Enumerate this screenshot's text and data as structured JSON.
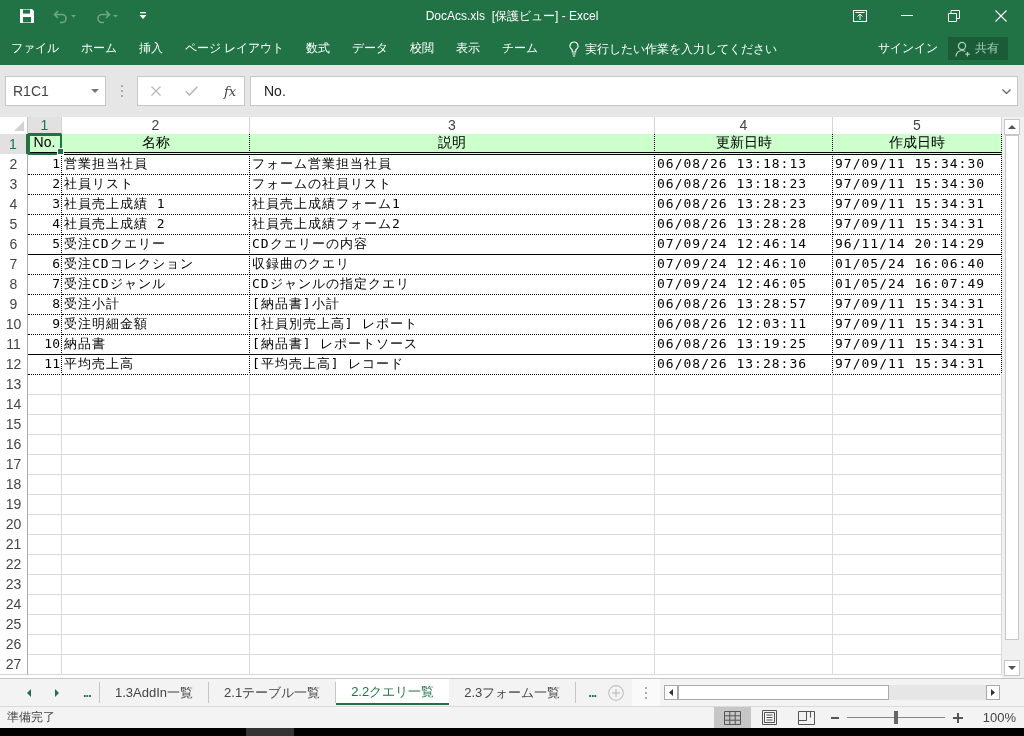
{
  "title_bar": {
    "quick_access": [
      {
        "kind": "save",
        "disabled": false
      },
      {
        "kind": "undo",
        "disabled": true
      },
      {
        "kind": "redo",
        "disabled": true
      },
      {
        "kind": "customize",
        "disabled": false
      }
    ],
    "title": "DocAcs.xls  [保護ビュー] - Excel"
  },
  "ribbon": {
    "tabs": [
      {
        "label": "ファイル",
        "selected": false
      },
      {
        "label": "ホーム",
        "selected": false
      },
      {
        "label": "挿入",
        "selected": false
      },
      {
        "label": "ページ レイアウト",
        "selected": false
      },
      {
        "label": "数式",
        "selected": false
      },
      {
        "label": "データ",
        "selected": false
      },
      {
        "label": "校閲",
        "selected": false
      },
      {
        "label": "表示",
        "selected": false
      },
      {
        "label": "チーム",
        "selected": false
      }
    ],
    "tell_me": {
      "placeholder": "実行したい作業を入力してください"
    },
    "sign_in": "サインイン",
    "share": {
      "label": "共有",
      "disabled": true
    }
  },
  "formula_bar": {
    "name_box": "R1C1",
    "buttons": [
      {
        "kind": "cancel",
        "disabled": true
      },
      {
        "kind": "enter",
        "disabled": true
      }
    ],
    "function_button": "fx",
    "value": "No."
  },
  "sheet": {
    "columns": [
      {
        "number": "1",
        "selected": true
      },
      {
        "number": "2",
        "selected": false
      },
      {
        "number": "3",
        "selected": false
      },
      {
        "number": "4",
        "selected": false
      },
      {
        "number": "5",
        "selected": false
      }
    ],
    "rows": [
      {
        "kind": "header",
        "number": "1",
        "selected": true,
        "cells": [
          "No.",
          "名称",
          "説明",
          "更新日時",
          "作成日時"
        ]
      },
      {
        "kind": "data",
        "number": "2",
        "selected": false,
        "rule_below": false,
        "cells": [
          "1",
          "営業担当社員",
          "フォーム営業担当社員",
          "06/08/26 13:18:13",
          "97/09/11 15:34:30"
        ]
      },
      {
        "kind": "data",
        "number": "3",
        "selected": false,
        "rule_below": false,
        "cells": [
          "2",
          "社員リスト",
          "フォームの社員リスト",
          "06/08/26 13:18:23",
          "97/09/11 15:34:30"
        ]
      },
      {
        "kind": "data",
        "number": "4",
        "selected": false,
        "rule_below": false,
        "cells": [
          "3",
          "社員売上成績 1",
          "社員売上成績フォーム1",
          "06/08/26 13:28:23",
          "97/09/11 15:34:31"
        ]
      },
      {
        "kind": "data",
        "number": "5",
        "selected": false,
        "rule_below": false,
        "cells": [
          "4",
          "社員売上成績 2",
          "社員売上成績フォーム2",
          "06/08/26 13:28:28",
          "97/09/11 15:34:31"
        ]
      },
      {
        "kind": "data",
        "number": "6",
        "selected": false,
        "rule_below": true,
        "cells": [
          "5",
          "受注CDクエリー",
          "CDクエリーの内容",
          "07/09/24 12:46:14",
          "96/11/14 20:14:29"
        ]
      },
      {
        "kind": "data",
        "number": "7",
        "selected": false,
        "rule_below": false,
        "cells": [
          "6",
          "受注CDコレクション",
          "収録曲のクエリ",
          "07/09/24 12:46:10",
          "01/05/24 16:06:40"
        ]
      },
      {
        "kind": "data",
        "number": "8",
        "selected": false,
        "rule_below": false,
        "cells": [
          "7",
          "受注CDジャンル",
          "CDジャンルの指定クエリ",
          "07/09/24 12:46:05",
          "01/05/24 16:07:49"
        ]
      },
      {
        "kind": "data",
        "number": "9",
        "selected": false,
        "rule_below": false,
        "cells": [
          "8",
          "受注小計",
          "[納品書]小計",
          "06/08/26 13:28:57",
          "97/09/11 15:34:31"
        ]
      },
      {
        "kind": "data",
        "number": "10",
        "selected": false,
        "rule_below": false,
        "cells": [
          "9",
          "受注明細金額",
          "[社員別売上高] レポート",
          "06/08/26 12:03:11",
          "97/09/11 15:34:31"
        ]
      },
      {
        "kind": "data",
        "number": "11",
        "selected": false,
        "rule_below": true,
        "cells": [
          "10",
          "納品書",
          "[納品書] レポートソース",
          "06/08/26 13:19:25",
          "97/09/11 15:34:31"
        ]
      },
      {
        "kind": "data",
        "number": "12",
        "selected": false,
        "rule_below": false,
        "cells": [
          "11",
          "平均売上高",
          "[平均売上高] レコード",
          "06/08/26 13:28:36",
          "97/09/11 15:34:31"
        ]
      },
      {
        "kind": "empty",
        "number": "13",
        "selected": false
      },
      {
        "kind": "empty",
        "number": "14",
        "selected": false
      },
      {
        "kind": "empty",
        "number": "15",
        "selected": false
      },
      {
        "kind": "empty",
        "number": "16",
        "selected": false
      },
      {
        "kind": "empty",
        "number": "17",
        "selected": false
      },
      {
        "kind": "empty",
        "number": "18",
        "selected": false
      },
      {
        "kind": "empty",
        "number": "19",
        "selected": false
      },
      {
        "kind": "empty",
        "number": "20",
        "selected": false
      },
      {
        "kind": "empty",
        "number": "21",
        "selected": false
      },
      {
        "kind": "empty",
        "number": "22",
        "selected": false
      },
      {
        "kind": "empty",
        "number": "23",
        "selected": false
      },
      {
        "kind": "empty",
        "number": "24",
        "selected": false
      },
      {
        "kind": "empty",
        "number": "25",
        "selected": false
      },
      {
        "kind": "empty",
        "number": "26",
        "selected": false
      },
      {
        "kind": "empty",
        "number": "27",
        "selected": false
      }
    ]
  },
  "sheet_tabs": {
    "overflow_left": "...",
    "tabs": [
      {
        "label": "1.3AddIn一覧",
        "selected": false
      },
      {
        "label": "2.1テーブル一覧",
        "selected": false
      },
      {
        "label": "2.2クエリ一覧",
        "selected": true
      },
      {
        "label": "2.3フォーム一覧",
        "selected": false
      }
    ],
    "overflow_right": "..."
  },
  "status_bar": {
    "status": "準備完了",
    "views": [
      {
        "kind": "normal",
        "selected": true
      },
      {
        "kind": "page-layout",
        "selected": false
      },
      {
        "kind": "page-break",
        "selected": false
      }
    ],
    "zoom": {
      "level": 0.5,
      "reading": "100%"
    }
  }
}
